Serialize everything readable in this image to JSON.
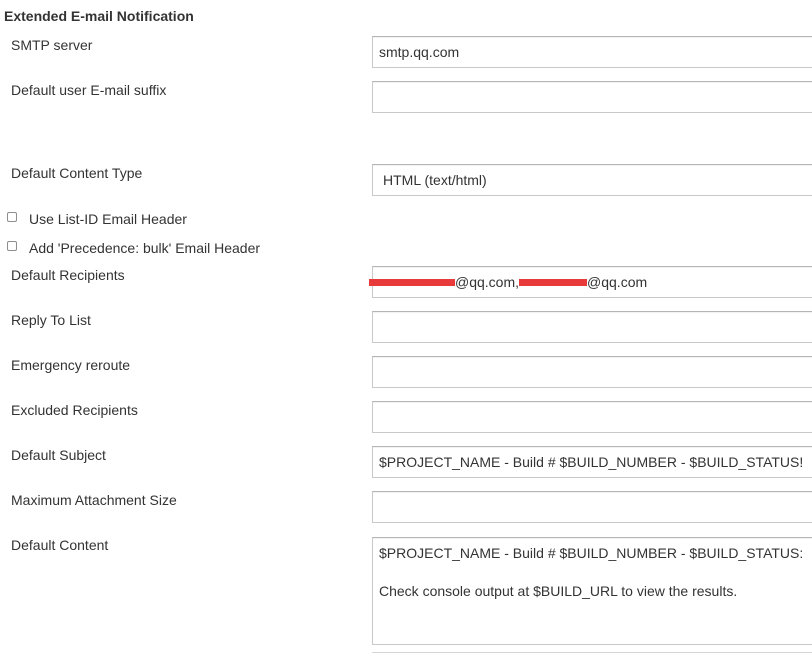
{
  "section": {
    "title": "Extended E-mail Notification"
  },
  "fields": {
    "smtp_server": {
      "label": "SMTP server",
      "value": "smtp.qq.com"
    },
    "default_suffix": {
      "label": "Default user E-mail suffix",
      "value": ""
    },
    "content_type": {
      "label": "Default Content Type",
      "value": "HTML (text/html)"
    },
    "list_id": {
      "label": "Use List-ID Email Header",
      "checked": false
    },
    "precedence": {
      "label": "Add 'Precedence: bulk' Email Header",
      "checked": false
    },
    "recipients": {
      "label": "Default Recipients",
      "part1": "@qq.com,",
      "part2": "@qq.com"
    },
    "reply_to": {
      "label": "Reply To List",
      "value": ""
    },
    "emergency": {
      "label": "Emergency reroute",
      "value": ""
    },
    "excluded": {
      "label": "Excluded Recipients",
      "value": ""
    },
    "subject": {
      "label": "Default Subject",
      "value": "$PROJECT_NAME - Build # $BUILD_NUMBER - $BUILD_STATUS!"
    },
    "attachment_size": {
      "label": "Maximum Attachment Size",
      "value": ""
    },
    "content": {
      "label": "Default Content",
      "value": "$PROJECT_NAME - Build # $BUILD_NUMBER - $BUILD_STATUS:\n\nCheck console output at $BUILD_URL to view the results."
    }
  },
  "colors": {
    "redaction": "#e83a3a"
  }
}
